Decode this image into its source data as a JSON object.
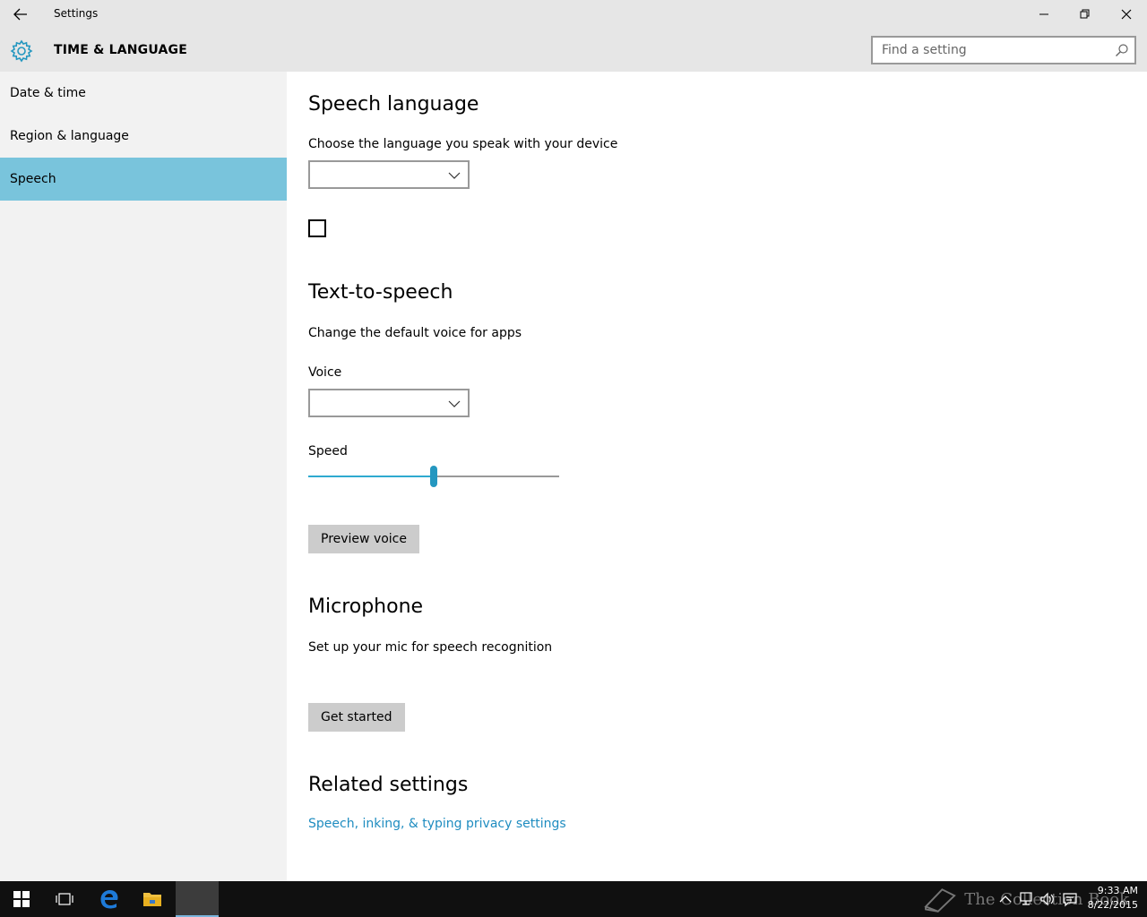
{
  "window": {
    "title": "Settings"
  },
  "header": {
    "title": "TIME & LANGUAGE",
    "search_placeholder": "Find a setting"
  },
  "sidebar": {
    "items": [
      {
        "label": "Date & time",
        "selected": false
      },
      {
        "label": "Region & language",
        "selected": false
      },
      {
        "label": "Speech",
        "selected": true
      }
    ]
  },
  "speech_language": {
    "heading": "Speech language",
    "description": "Choose the language you speak with your device",
    "language_value": "",
    "checkbox_checked": false
  },
  "tts": {
    "heading": "Text-to-speech",
    "description": "Change the default voice for apps",
    "voice_label": "Voice",
    "voice_value": "",
    "speed_label": "Speed",
    "speed_fraction": 0.5,
    "preview_button": "Preview voice"
  },
  "microphone": {
    "heading": "Microphone",
    "description": "Set up your mic for speech recognition",
    "button": "Get started"
  },
  "related": {
    "heading": "Related settings",
    "link": "Speech, inking, & typing privacy settings"
  },
  "taskbar": {
    "watermark": "The Collection Book",
    "time": "9:33 AM",
    "date": "8/22/2015"
  },
  "colors": {
    "accent": "#2eaad0",
    "sidebar_selected": "#79c4dc",
    "link": "#1e8cc0"
  }
}
